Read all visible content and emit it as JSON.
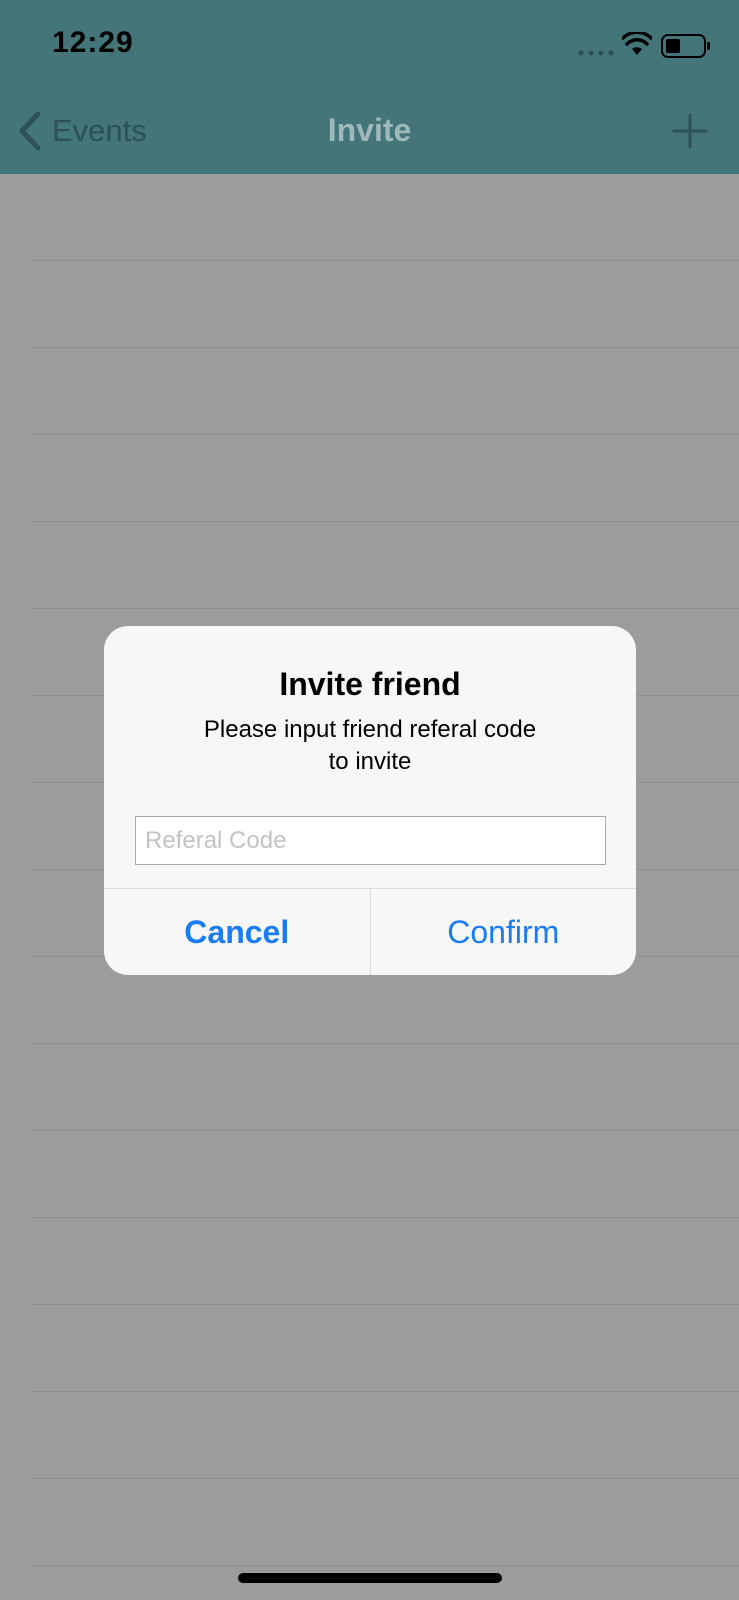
{
  "status_bar": {
    "time": "12:29",
    "icons": [
      "signal-icon",
      "wifi-icon",
      "battery-icon"
    ]
  },
  "nav": {
    "back_label": "Events",
    "title": "Invite",
    "back_icon": "chevron-left-icon",
    "add_icon": "plus-icon"
  },
  "colors": {
    "nav_background": "#437579",
    "overlay_background": "#9c9c9c",
    "alert_background": "#f7f7f7",
    "button_blue": "#1a7cf2"
  },
  "alert": {
    "title": "Invite friend",
    "message_line1": "Please input friend referal code",
    "message_line2": "to invite",
    "input_placeholder": "Referal Code",
    "input_value": "",
    "cancel_label": "Cancel",
    "confirm_label": "Confirm"
  }
}
